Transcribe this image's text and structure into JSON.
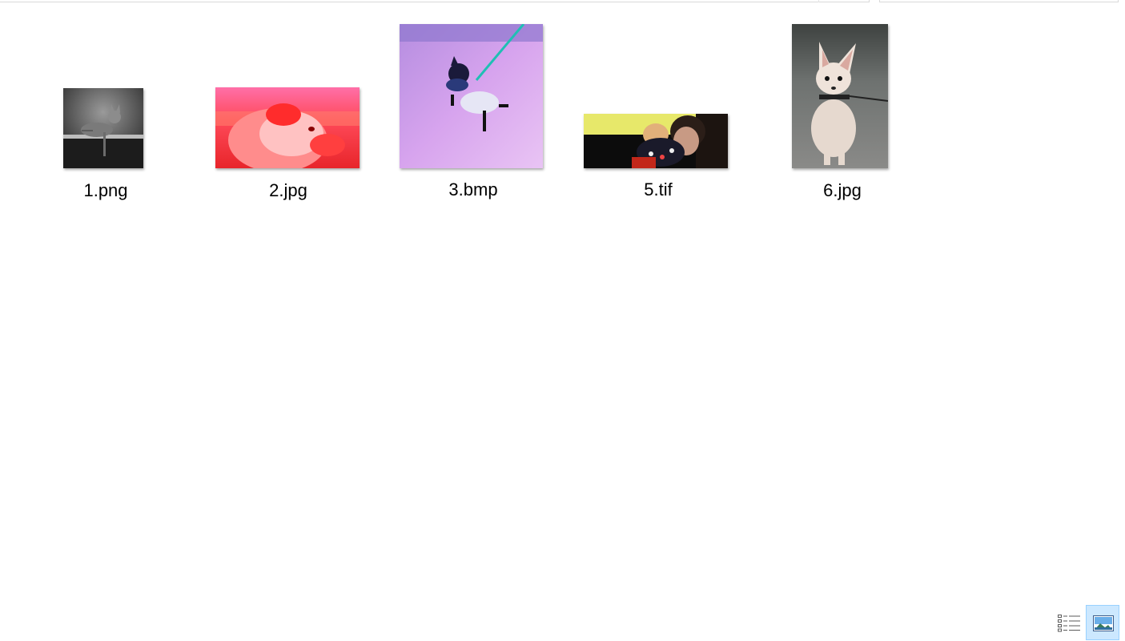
{
  "files": [
    {
      "name": "1.png",
      "thumbnail": "grayscale cat sitting on a ledge"
    },
    {
      "name": "2.jpg",
      "thumbnail": "red-tinted dog face close-up"
    },
    {
      "name": "3.bmp",
      "thumbnail": "color-inverted dog on a leash"
    },
    {
      "name": "5.tif",
      "thumbnail": "person holding a small dog"
    },
    {
      "name": "6.jpg",
      "thumbnail": "white chihuahua on gravel"
    }
  ],
  "view_buttons": {
    "details_icon": "details-view-icon",
    "large_icons_icon": "large-icons-view-icon",
    "selected": "large-icons"
  },
  "colors": {
    "selected_bg": "#cce8ff",
    "selected_border": "#99d1ff"
  }
}
